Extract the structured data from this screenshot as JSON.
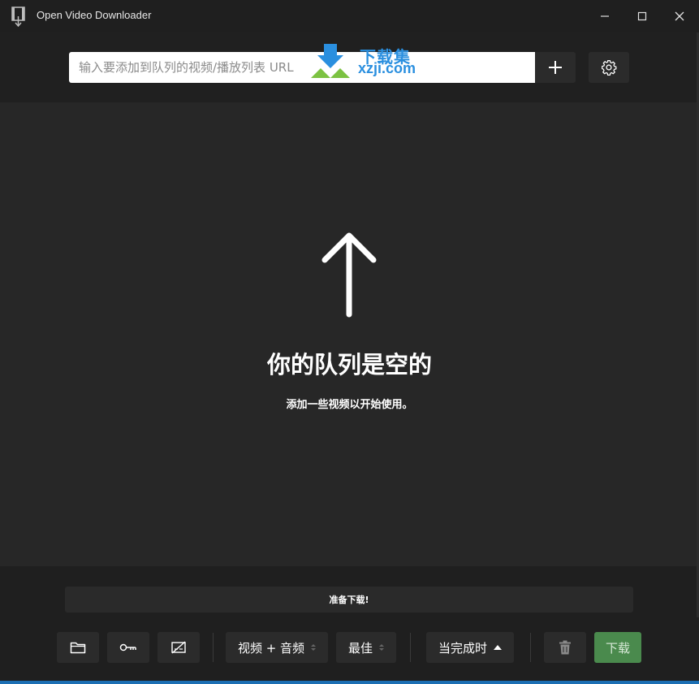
{
  "window": {
    "title": "Open Video Downloader",
    "app_icon": "film-download-icon",
    "controls": [
      "minimize-icon",
      "maximize-icon",
      "close-icon"
    ]
  },
  "toolbar": {
    "url_placeholder": "输入要添加到队列的视频/播放列表 URL",
    "add_icon": "plus-icon",
    "settings_icon": "gear-icon"
  },
  "watermark": {
    "cn": "下载集",
    "en": "xzji.com"
  },
  "queue": {
    "empty_icon": "arrow-up-icon",
    "empty_title": "你的队列是空的",
    "empty_subtitle": "添加一些视频以开始使用。"
  },
  "status": {
    "text": "准备下载!"
  },
  "bottom_toolbar": {
    "folder_icon": "folder-icon",
    "key_icon": "key-icon",
    "no_subtitles_icon": "subtitles-off-icon",
    "format_select": "视频 + 音频",
    "quality_select": "最佳",
    "when_done_select": "当完成时",
    "trash_icon": "trash-icon",
    "download_label": "下载"
  },
  "colors": {
    "background": "#1f1f1f",
    "queue_background": "#272727",
    "button_background": "#2b2b2b",
    "download_green": "#4a8a4d",
    "watermark_blue": "#2a8fdf",
    "accent_blue": "#1c6fb3"
  }
}
